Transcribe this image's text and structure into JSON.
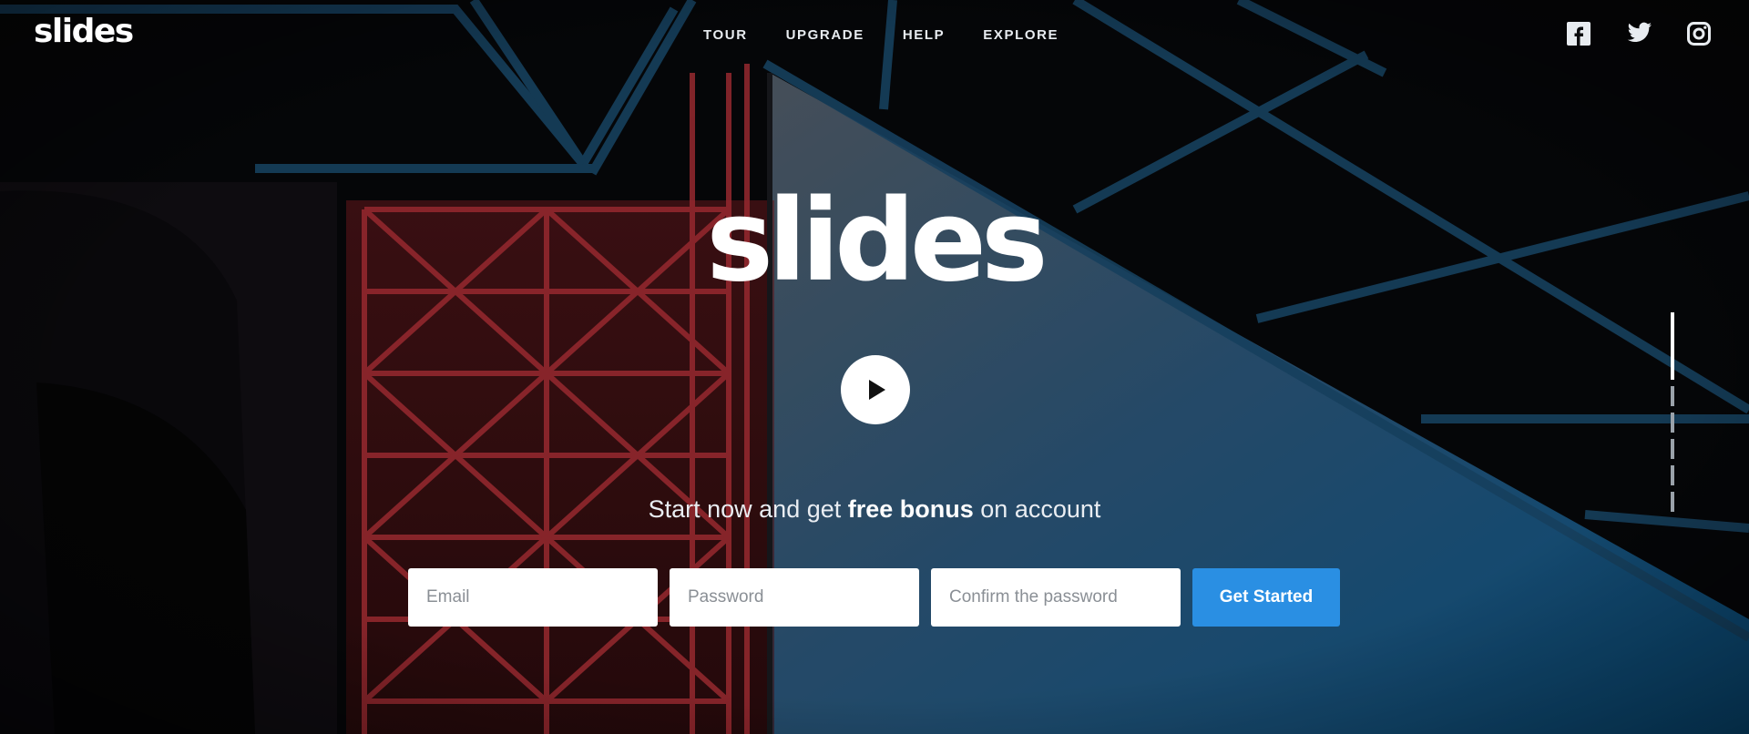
{
  "brand": {
    "logo_small": "slides",
    "hero_title": "slides"
  },
  "nav": {
    "items": [
      "TOUR",
      "UPGRADE",
      "HELP",
      "EXPLORE"
    ]
  },
  "social": [
    "facebook-icon",
    "twitter-icon",
    "instagram-icon"
  ],
  "hero": {
    "tagline_prefix": "Start now and get ",
    "tagline_bold": "free bonus",
    "tagline_suffix": " on account"
  },
  "form": {
    "email_placeholder": "Email",
    "password_placeholder": "Password",
    "confirm_placeholder": "Confirm the password",
    "submit_label": "Get Started"
  },
  "pager": {
    "count": 6,
    "active_index": 0
  },
  "colors": {
    "accent": "#2a8fe3",
    "background": "#050608",
    "sky": "#1e5a85",
    "girder": "#a3262a"
  }
}
